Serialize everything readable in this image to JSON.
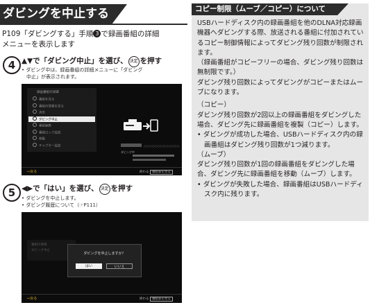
{
  "section_title": "ダビングを中止する",
  "intro": {
    "line1_a": "P109「ダビングする」手順",
    "step_ref": "3",
    "line1_b": "で録画番組の詳細",
    "line2": "メニューを表示します"
  },
  "step4": {
    "number": "4",
    "heading_a": "▲▼で「ダビング中止」を選び、",
    "key_label": "決定",
    "heading_b": "を押す",
    "note1": "• ダビング中は、録画番組の詳細メニューに「ダビング",
    "note2": "　中止」が表示されます。"
  },
  "screen1": {
    "menu_title": "録画番組の詳細",
    "menu_items": [
      {
        "label": "番組を見る",
        "selected": false
      },
      {
        "label": "番組の情報を見る",
        "selected": false
      },
      {
        "label": "消去",
        "selected": false
      },
      {
        "label": "ダビング中止",
        "selected": true
      },
      {
        "label": "番組編集",
        "selected": false
      },
      {
        "label": "番組ロック設定",
        "selected": false
      },
      {
        "label": "移動",
        "selected": false
      },
      {
        "label": "チャプター設定",
        "selected": false
      }
    ],
    "status_label": "ダビング中",
    "return_label": "戻る",
    "end_label": "終わる",
    "end_key": "番組表を見る"
  },
  "step5": {
    "number": "5",
    "heading_a": "◀▶で「はい」を選び、",
    "key_label": "決定",
    "heading_b": "を押す",
    "note1": "• ダビングを中止します。",
    "note2": "• ダビング履歴について（☞P111）"
  },
  "screen2": {
    "dialog_text": "ダビングを中止しますか？",
    "yes_label": "はい",
    "no_label": "いいえ",
    "menu_items": [
      "番組の情報",
      "ダビング中止"
    ],
    "return_label": "戻る",
    "end_label": "終わる",
    "end_key": "番組表を見る"
  },
  "copy_control": {
    "heading": "コピー制限（ムーブ／コピー）について",
    "para1": "USBハードディスク内の録画番組を他のDLNA対応録画機器へダビングする際、放送される番組に付加されているコピー制御情報によってダビング残り回数が制限されます。",
    "para2": "（録画番組がコピーフリーの場合、ダビング残り回数は無制限です。）",
    "para3": "ダビング残り回数によってダビングがコピーまたはムーブになります。",
    "copy_label": "（コピー）",
    "copy_text": "ダビング残り回数が2回以上の録画番組をダビングした場合、ダビング先に録画番組を複製（コピー）します。",
    "copy_bullet": "• ダビングが成功した場合、USBハードディスク内の録画番組はダビング残り回数が1つ減ります。",
    "move_label": "（ムーブ）",
    "move_text": "ダビング残り回数が1回の録画番組をダビングした場合、ダビング先に録画番組を移動（ムーブ）します。",
    "move_bullet": "• ダビングが失敗した場合、録画番組はUSBハードディスク内に残ります。"
  }
}
